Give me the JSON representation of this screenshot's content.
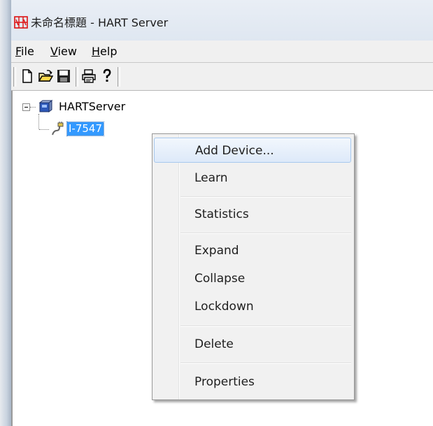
{
  "window": {
    "title": "未命名標題 - HART Server"
  },
  "menubar": {
    "items": [
      "File",
      "View",
      "Help"
    ]
  },
  "toolbar": {
    "buttons": [
      "new-file-icon",
      "open-folder-icon",
      "save-icon",
      "print-icon",
      "help-icon"
    ]
  },
  "tree": {
    "root": {
      "label": "HARTServer",
      "expanded": true
    },
    "child": {
      "label": "I-7547",
      "selected": true
    }
  },
  "context_menu": {
    "items": [
      {
        "label": "Add Device...",
        "highlighted": true
      },
      {
        "label": "Learn"
      },
      {
        "label": "Statistics"
      },
      {
        "label": "Expand"
      },
      {
        "label": "Collapse"
      },
      {
        "label": "Lockdown"
      },
      {
        "label": "Delete"
      },
      {
        "label": "Properties"
      }
    ]
  },
  "colors": {
    "selection": "#3399ff",
    "menu_background": "#f1f1f1",
    "hover_border": "#a8c9ee"
  }
}
